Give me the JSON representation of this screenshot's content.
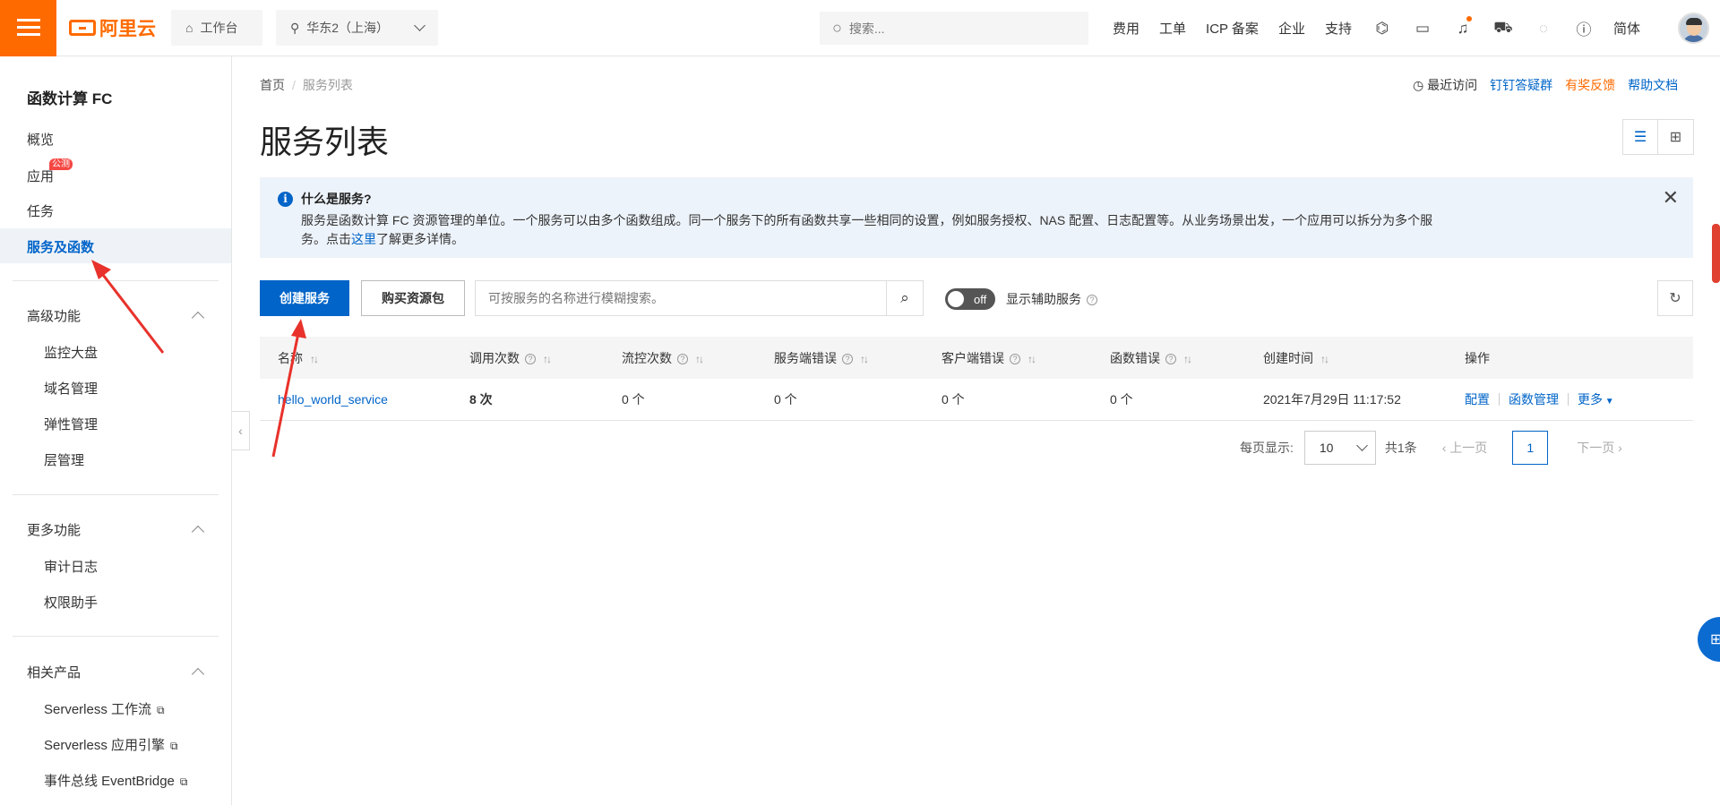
{
  "topbar": {
    "logo_text": "阿里云",
    "workbench": "工作台",
    "region": "华东2（上海）",
    "search_placeholder": "搜索...",
    "links": [
      "费用",
      "工单",
      "ICP 备案",
      "企业",
      "支持"
    ],
    "lang": "简体"
  },
  "sidebar": {
    "title": "函数计算 FC",
    "items": [
      "概览",
      "应用",
      "任务",
      "服务及函数"
    ],
    "app_badge": "公测",
    "advanced": {
      "label": "高级功能",
      "items": [
        "监控大盘",
        "域名管理",
        "弹性管理",
        "层管理"
      ]
    },
    "more": {
      "label": "更多功能",
      "items": [
        "审计日志",
        "权限助手"
      ]
    },
    "related": {
      "label": "相关产品",
      "items": [
        "Serverless 工作流",
        "Serverless 应用引擎",
        "事件总线 EventBridge"
      ]
    }
  },
  "breadcrumb": {
    "home": "首页",
    "sep": "/",
    "current": "服务列表"
  },
  "header_links": {
    "recent": "最近访问",
    "dingtalk": "钉钉答疑群",
    "feedback": "有奖反馈",
    "docs": "帮助文档"
  },
  "page_title": "服务列表",
  "info": {
    "title": "什么是服务?",
    "body": "服务是函数计算 FC 资源管理的单位。一个服务可以由多个函数组成。同一个服务下的所有函数共享一些相同的设置，例如服务授权、NAS 配置、日志配置等。从业务场景出发，一个应用可以拆分为多个服务。点击",
    "link": "这里",
    "tail": "了解更多详情。"
  },
  "toolbar": {
    "create": "创建服务",
    "buy": "购买资源包",
    "search_placeholder": "可按服务的名称进行模糊搜索。",
    "toggle": "off",
    "aux_label": "显示辅助服务"
  },
  "table": {
    "headers": [
      "名称",
      "调用次数",
      "流控次数",
      "服务端错误",
      "客户端错误",
      "函数错误",
      "创建时间",
      "操作"
    ],
    "rows": [
      {
        "name": "hello_world_service",
        "calls": "8 次",
        "throttles": "0 个",
        "server_errors": "0 个",
        "client_errors": "0 个",
        "func_errors": "0 个",
        "created": "2021年7月29日 11:17:52",
        "op_config": "配置",
        "op_funcs": "函数管理",
        "op_more": "更多"
      }
    ]
  },
  "pager": {
    "per_page_label": "每页显示:",
    "per_page": "10",
    "total": "共1条",
    "prev": "上一页",
    "page": "1",
    "next": "下一页"
  },
  "colors": {
    "brand": "#ff6a00",
    "primary": "#0064c8",
    "annotation_arrow": "#e8322b"
  }
}
